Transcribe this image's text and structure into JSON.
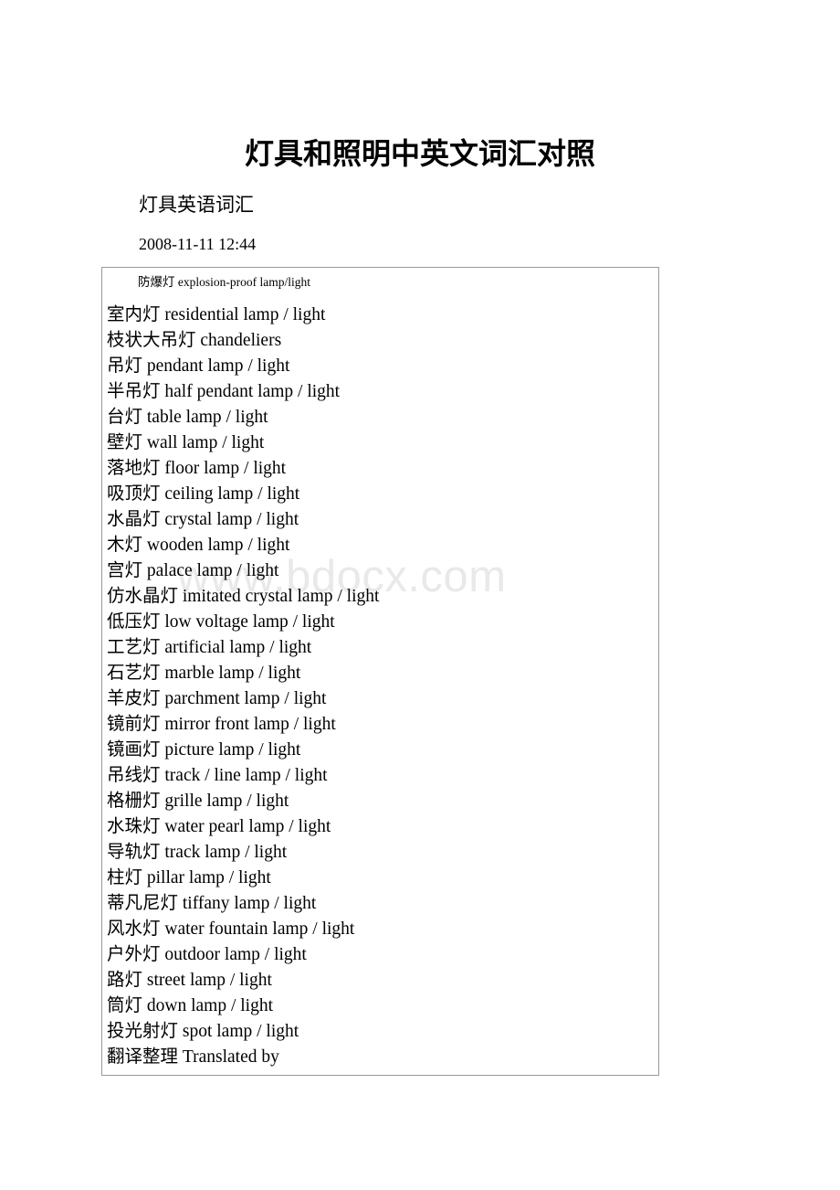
{
  "document": {
    "title": "灯具和照明中英文词汇对照",
    "subtitle": "灯具英语词汇",
    "timestamp": "2008-11-11 12:44",
    "watermark": "www.bdocx.com"
  },
  "vocab_box": {
    "first_entry": "防爆灯 explosion-proof lamp/light",
    "entries": [
      "室内灯 residential lamp / light",
      "枝状大吊灯 chandeliers",
      "吊灯 pendant lamp / light",
      "半吊灯 half pendant lamp / light",
      "台灯 table lamp / light",
      "壁灯 wall lamp / light",
      "落地灯 floor lamp / light",
      "吸顶灯 ceiling lamp / light",
      "水晶灯 crystal lamp / light",
      "木灯 wooden lamp / light",
      "宫灯 palace lamp / light",
      "仿水晶灯 imitated crystal lamp / light",
      "低压灯 low voltage lamp / light",
      "工艺灯 artificial lamp / light",
      "石艺灯 marble lamp / light",
      "羊皮灯 parchment lamp / light",
      "镜前灯 mirror front lamp / light",
      "镜画灯 picture lamp / light",
      "吊线灯 track / line lamp / light",
      "格栅灯 grille lamp / light",
      "水珠灯 water pearl lamp / light",
      "导轨灯 track lamp / light",
      "柱灯 pillar lamp / light",
      "蒂凡尼灯 tiffany lamp / light",
      "风水灯 water fountain lamp / light",
      "户外灯 outdoor lamp / light",
      "路灯 street lamp / light",
      "筒灯 down lamp / light",
      "投光射灯 spot lamp / light",
      "翻译整理 Translated by"
    ]
  }
}
